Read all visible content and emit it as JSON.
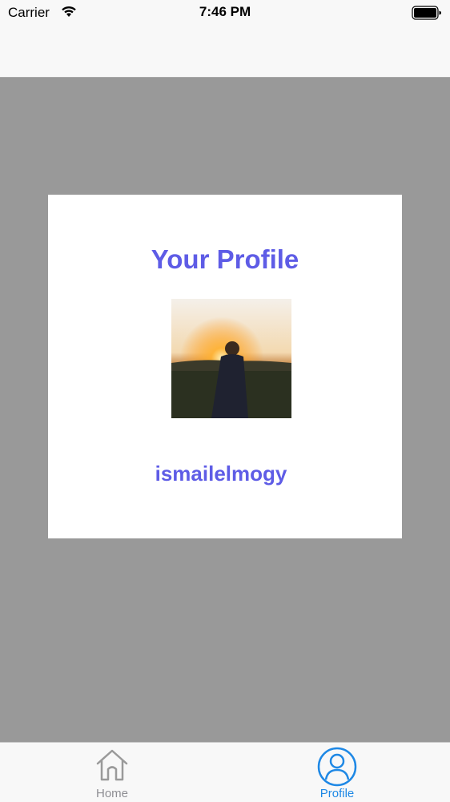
{
  "status_bar": {
    "carrier": "Carrier",
    "time": "7:46 PM"
  },
  "profile_card": {
    "title": "Your Profile",
    "username": "ismailelmogy"
  },
  "tab_bar": {
    "items": [
      {
        "label": "Home",
        "icon": "home-icon",
        "selected": false
      },
      {
        "label": "Profile",
        "icon": "person-icon",
        "selected": true
      }
    ]
  },
  "colors": {
    "accent": "#5e5ce6",
    "tab_selected": "#1e88e5",
    "tab_unselected": "#8e8e93",
    "background": "#999999"
  }
}
